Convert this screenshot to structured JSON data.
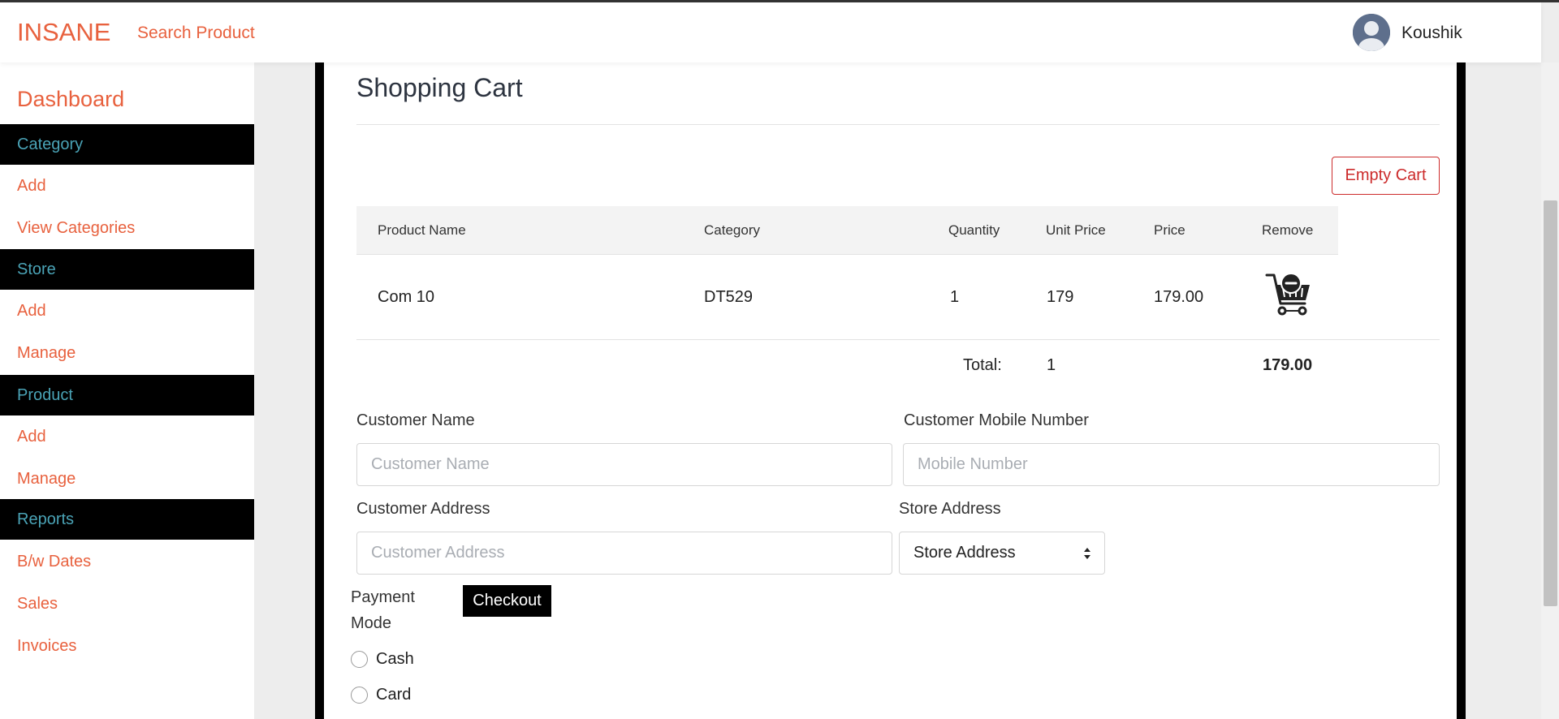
{
  "navbar": {
    "brand": "INSANE",
    "search_link": "Search Product",
    "username": "Koushik",
    "avatar_icon": "user-avatar-icon"
  },
  "sidebar": {
    "title": "Dashboard",
    "sections": [
      {
        "heading": "Category",
        "links": [
          "Add",
          "View Categories"
        ]
      },
      {
        "heading": "Store",
        "links": [
          "Add",
          "Manage"
        ]
      },
      {
        "heading": "Product",
        "links": [
          "Add",
          "Manage"
        ]
      },
      {
        "heading": "Reports",
        "links": [
          "B/w Dates",
          "Sales",
          "Invoices"
        ]
      }
    ]
  },
  "cart": {
    "title": "Shopping Cart",
    "empty_button": "Empty Cart",
    "columns": [
      "Product Name",
      "Category",
      "Quantity",
      "Unit Price",
      "Price",
      "Remove"
    ],
    "rows": [
      {
        "product_name": "Com 10",
        "category": "DT529",
        "quantity": "1",
        "unit_price": "179",
        "price": "179.00",
        "remove_icon": "cart-remove-icon"
      }
    ],
    "total_label": "Total:",
    "total_quantity": "1",
    "total_price": "179.00"
  },
  "form": {
    "customer_name_label": "Customer Name",
    "customer_name_placeholder": "Customer Name",
    "customer_mobile_label": "Customer Mobile Number",
    "customer_mobile_placeholder": "Mobile Number",
    "customer_address_label": "Customer Address",
    "customer_address_placeholder": "Customer Address",
    "store_address_label": "Store Address",
    "store_address_selected": "Store Address",
    "payment_mode_label_line1": "Payment",
    "payment_mode_label_line2": "Mode",
    "payment_options": [
      "Cash",
      "Card"
    ],
    "checkout_button": "Checkout"
  },
  "colors": {
    "accent": "#e8613e",
    "sidebar_heading_text": "#4aa3b6",
    "danger": "#cc2b2b"
  }
}
